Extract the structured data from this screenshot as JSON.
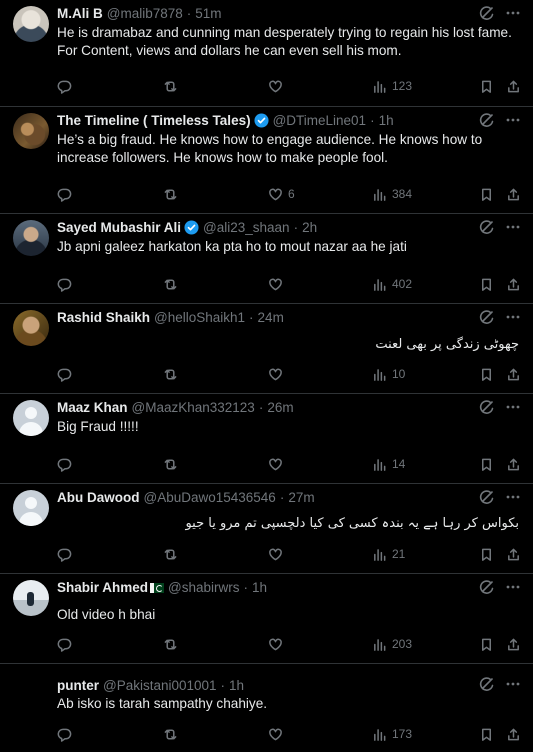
{
  "tweets": [
    {
      "name": "M.Ali B",
      "handle": "@malib7878",
      "time": "51m",
      "text": "He is dramabaz and cunning man desperately trying to regain his lost fame. For Content, views and dollars he can even sell his mom.",
      "replies": "",
      "reposts": "",
      "likes": "",
      "views": "123",
      "verified": false,
      "avatar": "photo"
    },
    {
      "name": "The Timeline ( Timeless Tales)",
      "handle": "@DTimeLine01",
      "time": "1h",
      "text": "He’s a big fraud. He knows how to engage audience. He knows how to increase followers. He knows how to make people fool.",
      "replies": "",
      "reposts": "",
      "likes": "6",
      "views": "384",
      "verified": true,
      "avatar": "photo"
    },
    {
      "name": "Sayed Mubashir Ali",
      "handle": "@ali23_shaan",
      "time": "2h",
      "text": "Jb apni galeez harkaton ka pta ho to mout nazar aa he jati",
      "replies": "",
      "reposts": "",
      "likes": "",
      "views": "402",
      "verified": true,
      "avatar": "photo"
    },
    {
      "name": "Rashid Shaikh",
      "handle": "@helloShaikh1",
      "time": "24m",
      "text": "چھوٹی زندگی پر بھی لعنت",
      "replies": "",
      "reposts": "",
      "likes": "",
      "views": "10",
      "verified": false,
      "avatar": "photo"
    },
    {
      "name": "Maaz Khan",
      "handle": "@MaazKhan332123",
      "time": "26m",
      "text": "Big Fraud !!!!!",
      "replies": "",
      "reposts": "",
      "likes": "",
      "views": "14",
      "verified": false,
      "avatar": "default"
    },
    {
      "name": "Abu Dawood",
      "handle": "@AbuDawo15436546",
      "time": "27m",
      "text": "بکواس کر رہا ہے یہ بندہ کسی کی کیا دلچسپی تم مرو یا جیو",
      "replies": "",
      "reposts": "",
      "likes": "",
      "views": "21",
      "verified": false,
      "avatar": "default"
    },
    {
      "name": "Shabir Ahmed",
      "handle": "@shabirwrs",
      "time": "1h",
      "text": "Old video h bhai",
      "replies": "",
      "reposts": "",
      "likes": "",
      "views": "203",
      "verified": false,
      "avatar": "photo"
    },
    {
      "name": "punter",
      "handle": "@Pakistani001001",
      "time": "1h",
      "text": "Ab isko is tarah sampathy chahiye.",
      "replies": "",
      "reposts": "",
      "likes": "",
      "views": "173",
      "verified": false,
      "avatar": "none"
    }
  ],
  "icons": {
    "grok": "grok-icon",
    "more": "more-icon",
    "reply": "reply-icon",
    "repost": "repost-icon",
    "like": "like-icon",
    "views": "views-icon",
    "bookmark": "bookmark-icon",
    "share": "share-icon",
    "verified": "verified-badge-icon",
    "flag": "pakistan-flag-icon"
  },
  "colors": {
    "background": "#000000",
    "text": "#e7e9ea",
    "muted": "#71767b",
    "divider": "#2f3336",
    "verified": "#1d9bf0"
  }
}
